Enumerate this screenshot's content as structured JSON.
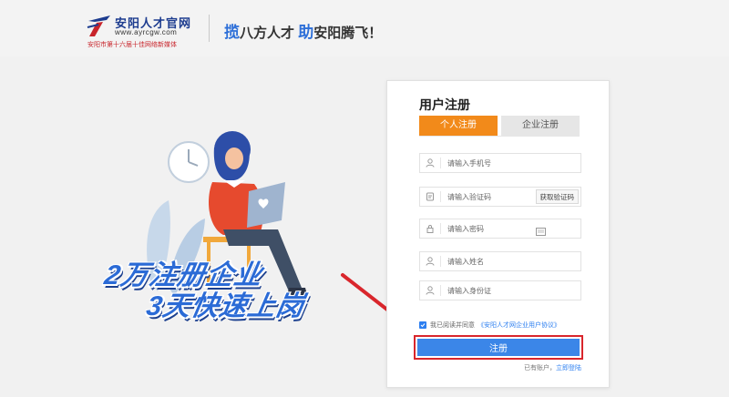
{
  "header": {
    "logo_name": "安阳人才官网",
    "logo_url": "www.ayrcgw.com",
    "logo_sub": "安阳市第十六届十佳网络新媒体",
    "slogan_hl1": "揽",
    "slogan_mid": "八方人才",
    "slogan_hl2": "助",
    "slogan_end": "安阳腾飞！"
  },
  "promo": {
    "line1": "2万注册企业",
    "line2": "3天快速上岗"
  },
  "form": {
    "title": "用户注册",
    "tabs": [
      {
        "label": "个人注册",
        "active": true
      },
      {
        "label": "企业注册",
        "active": false
      }
    ],
    "fields": {
      "phone": {
        "placeholder": "请输入手机号",
        "icon": "user-icon"
      },
      "code": {
        "placeholder": "请输入验证码",
        "icon": "shield-icon",
        "button": "获取验证码"
      },
      "password": {
        "placeholder": "请输入密码",
        "icon": "lock-icon"
      },
      "name": {
        "placeholder": "请输入姓名",
        "icon": "user-icon"
      },
      "id_card": {
        "placeholder": "请输入身份证",
        "icon": "user-icon"
      }
    },
    "agree_text": "我已阅读并同意",
    "agree_link": "《安阳人才网企业用户协议》",
    "submit": "注册",
    "has_account": "已有账户，",
    "login_link": "立即登陆"
  },
  "colors": {
    "accent_orange": "#f28a1a",
    "primary_blue": "#3b86e8",
    "highlight_red": "#d9262c"
  }
}
